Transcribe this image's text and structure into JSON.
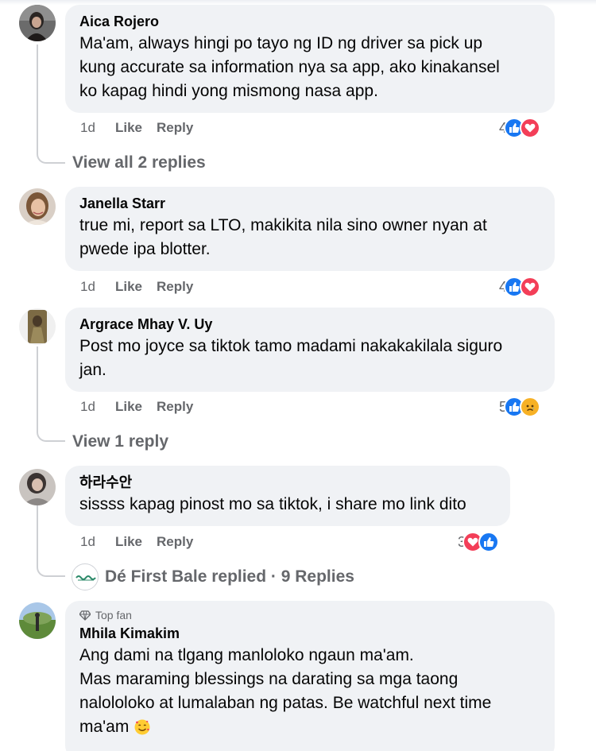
{
  "comments": [
    {
      "author": "Aica Rojero",
      "lines": [
        "Ma'am, always hingi po tayo ng ID ng driver sa pick up",
        "kung accurate sa information nya sa app, ako kinakansel",
        "ko kapag hindi yong mismong nasa app."
      ],
      "age": "1d",
      "like": "Like",
      "reply": "Reply",
      "reaction_count": "4",
      "reactions": [
        "like-icon",
        "love-icon"
      ],
      "view_replies": "View all 2 replies"
    },
    {
      "author": "Janella Starr",
      "lines": [
        "true mi, report sa LTO, makikita nila sino owner nyan at",
        "pwede ipa blotter."
      ],
      "age": "1d",
      "like": "Like",
      "reply": "Reply",
      "reaction_count": "4",
      "reactions": [
        "like-icon",
        "love-icon"
      ]
    },
    {
      "author": "Argrace Mhay V. Uy",
      "lines": [
        "Post mo joyce sa tiktok tamo madami nakakakilala siguro",
        "jan."
      ],
      "age": "1d",
      "like": "Like",
      "reply": "Reply",
      "reaction_count": "5",
      "reactions": [
        "like-icon",
        "sad-icon"
      ],
      "view_replies": "View 1 reply"
    },
    {
      "author": "하라수안",
      "lines": [
        "sissss kapag pinost mo sa tiktok, i share mo link dito"
      ],
      "age": "1d",
      "like": "Like",
      "reply": "Reply",
      "reaction_count": "3",
      "reactions": [
        "love-icon",
        "like-icon"
      ],
      "replied": "Dé First Bale replied · 9 Replies"
    },
    {
      "badge": "Top fan",
      "author": "Mhila Kimakim",
      "lines": [
        "Ang dami na tlgang manloloko ngaun ma'am.",
        "Mas maraming blessings na darating sa mga taong",
        "nalololoko at lumalaban ng patas. Be watchful next time",
        "ma'am"
      ],
      "emoji": "smiling-face-with-hearts-icon"
    }
  ],
  "colors": {
    "bubble": "#f0f2f5",
    "meta_text": "#65676b",
    "like_blue": "#1877f2",
    "love_red": "#f33e58",
    "sad_yellow": "#f7b125"
  }
}
